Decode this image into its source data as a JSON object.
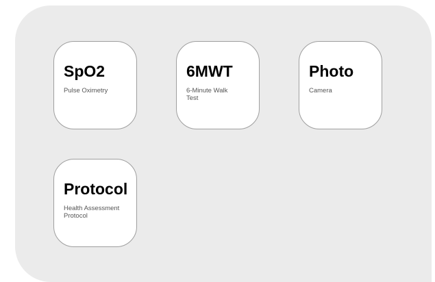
{
  "tiles": [
    {
      "title": "SpO2",
      "subtitle": "Pulse Oximetry"
    },
    {
      "title": "6MWT",
      "subtitle": "6-Minute Walk Test"
    },
    {
      "title": "Photo",
      "subtitle": "Camera"
    },
    {
      "title": "Protocol",
      "subtitle": "Health Assessment Protocol"
    }
  ]
}
